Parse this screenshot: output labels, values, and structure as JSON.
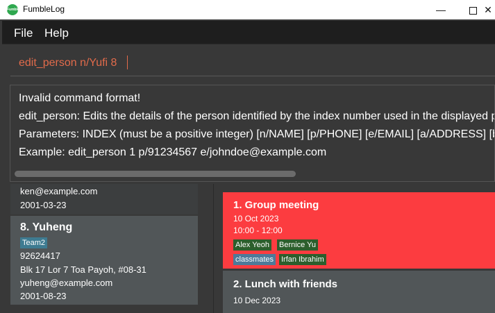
{
  "window": {
    "title": "FumbleLog",
    "icon_text": "FumbleLog",
    "minimize_glyph": "—",
    "close_glyph": "✕"
  },
  "menu": {
    "file": "File",
    "help": "Help"
  },
  "command": {
    "value": "edit_person n/Yufi 8"
  },
  "result": {
    "lines": [
      "Invalid command format!",
      "edit_person: Edits the details of the person identified by the index number used in the displayed person list.",
      "Parameters: INDEX (must be a positive integer) [n/NAME] [p/PHONE] [e/EMAIL] [a/ADDRESS] [b/BIRTHDAY]",
      "Example: edit_person 1 p/91234567 e/johndoe@example.com"
    ]
  },
  "persons": [
    {
      "email": "ken@example.com",
      "birthday": "2001-03-23"
    },
    {
      "name": "8.  Yuheng",
      "tag": "Team2",
      "phone": "92624417",
      "address": "Blk 17 Lor 7 Toa Payoh, #08-31",
      "email": "yuheng@example.com",
      "birthday": "2001-08-23"
    }
  ],
  "events": [
    {
      "title": "1.  Group meeting",
      "date": "10 Oct 2023",
      "time": "10:00 - 12:00",
      "tags": [
        "Alex Yeoh",
        "Bernice Yu",
        "classmates",
        "Irfan Ibrahim"
      ]
    },
    {
      "title": "2.  Lunch with friends",
      "date": "10 Dec 2023"
    }
  ],
  "colors": {
    "accent_command": "#e26b4b",
    "event_highlight": "#fc3c40",
    "person_tag": "#3e7b91",
    "event_person_tag": "#2c5e2c",
    "event_group_tag": "#4e7a99"
  }
}
